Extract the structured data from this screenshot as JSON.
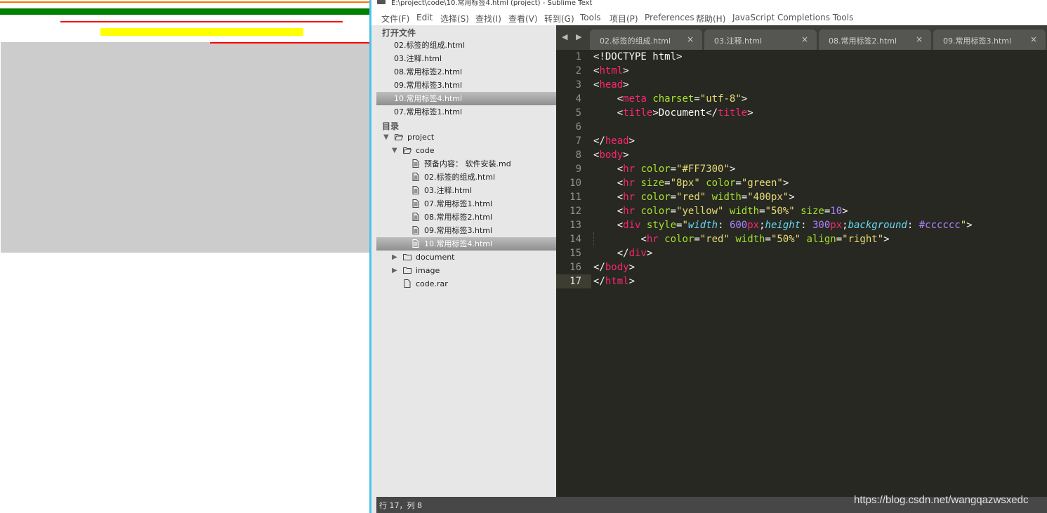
{
  "window": {
    "title": "E:\\project\\code\\10.常用标签4.html (project) - Sublime Text"
  },
  "menu": [
    "文件(F)",
    "Edit",
    "选择(S)",
    "查找(I)",
    "查看(V)",
    "转到(G)",
    "Tools",
    "项目(P)",
    "Preferences",
    "帮助(H)",
    "JavaScript Completions Tools"
  ],
  "sidebar": {
    "open_files_heading": "打开文件",
    "open_files": [
      {
        "label": "02.标签的组成.html"
      },
      {
        "label": "03.注释.html"
      },
      {
        "label": "08.常用标签2.html"
      },
      {
        "label": "09.常用标签3.html"
      },
      {
        "label": "10.常用标签4.html",
        "selected": true
      },
      {
        "label": "07.常用标签1.html"
      }
    ],
    "folders_heading": "目录",
    "tree": [
      {
        "label": "project",
        "type": "folder-open"
      },
      {
        "label": "code",
        "type": "folder-open"
      },
      {
        "label": "预备内容： 软件安装.md",
        "type": "file"
      },
      {
        "label": "02.标签的组成.html",
        "type": "file"
      },
      {
        "label": "03.注释.html",
        "type": "file"
      },
      {
        "label": "07.常用标签1.html",
        "type": "file"
      },
      {
        "label": "08.常用标签2.html",
        "type": "file"
      },
      {
        "label": "09.常用标签3.html",
        "type": "file"
      },
      {
        "label": "10.常用标签4.html",
        "type": "file",
        "selected": true
      },
      {
        "label": "document",
        "type": "folder"
      },
      {
        "label": "image",
        "type": "folder"
      },
      {
        "label": "code.rar",
        "type": "file"
      }
    ]
  },
  "tabs": [
    {
      "label": "02.标签的组成.html",
      "close": "×"
    },
    {
      "label": "03.注释.html",
      "close": "×"
    },
    {
      "label": "08.常用标签2.html",
      "close": "×"
    },
    {
      "label": "09.常用标签3.html",
      "close": "×"
    }
  ],
  "tab_nav": "◀ ▶",
  "code": {
    "line_numbers": [
      "1",
      "2",
      "3",
      "4",
      "5",
      "6",
      "7",
      "8",
      "9",
      "10",
      "11",
      "12",
      "13",
      "14",
      "15",
      "16",
      "17"
    ],
    "current_line": 17,
    "lines": [
      [
        [
          "text",
          "<!DOCTYPE html>"
        ]
      ],
      [
        [
          "pun",
          "<"
        ],
        [
          "tag",
          "html"
        ],
        [
          "pun",
          ">"
        ]
      ],
      [
        [
          "pun",
          "<"
        ],
        [
          "tag",
          "head"
        ],
        [
          "pun",
          ">"
        ]
      ],
      [
        [
          "pun",
          "    <"
        ],
        [
          "tag",
          "meta"
        ],
        [
          "pun",
          " "
        ],
        [
          "attr",
          "charset"
        ],
        [
          "pun",
          "="
        ],
        [
          "str",
          "\"utf-8\""
        ],
        [
          "pun",
          ">"
        ]
      ],
      [
        [
          "pun",
          "    <"
        ],
        [
          "tag",
          "title"
        ],
        [
          "pun",
          ">"
        ],
        [
          "text",
          "Document"
        ],
        [
          "pun",
          "</"
        ],
        [
          "tag",
          "title"
        ],
        [
          "pun",
          ">"
        ]
      ],
      [],
      [
        [
          "pun",
          "</"
        ],
        [
          "tag",
          "head"
        ],
        [
          "pun",
          ">"
        ]
      ],
      [
        [
          "pun",
          "<"
        ],
        [
          "tag",
          "body"
        ],
        [
          "pun",
          ">"
        ]
      ],
      [
        [
          "pun",
          "    <"
        ],
        [
          "tag",
          "hr"
        ],
        [
          "pun",
          " "
        ],
        [
          "attr",
          "color"
        ],
        [
          "pun",
          "="
        ],
        [
          "str",
          "\"#FF7300\""
        ],
        [
          "pun",
          ">"
        ]
      ],
      [
        [
          "pun",
          "    <"
        ],
        [
          "tag",
          "hr"
        ],
        [
          "pun",
          " "
        ],
        [
          "attr",
          "size"
        ],
        [
          "pun",
          "="
        ],
        [
          "str",
          "\"8px\""
        ],
        [
          "pun",
          " "
        ],
        [
          "attr",
          "color"
        ],
        [
          "pun",
          "="
        ],
        [
          "str",
          "\"green\""
        ],
        [
          "pun",
          ">"
        ]
      ],
      [
        [
          "pun",
          "    <"
        ],
        [
          "tag",
          "hr"
        ],
        [
          "pun",
          " "
        ],
        [
          "attr",
          "color"
        ],
        [
          "pun",
          "="
        ],
        [
          "str",
          "\"red\""
        ],
        [
          "pun",
          " "
        ],
        [
          "attr",
          "width"
        ],
        [
          "pun",
          "="
        ],
        [
          "str",
          "\"400px\""
        ],
        [
          "pun",
          ">"
        ]
      ],
      [
        [
          "pun",
          "    <"
        ],
        [
          "tag",
          "hr"
        ],
        [
          "pun",
          " "
        ],
        [
          "attr",
          "color"
        ],
        [
          "pun",
          "="
        ],
        [
          "str",
          "\"yellow\""
        ],
        [
          "pun",
          " "
        ],
        [
          "attr",
          "width"
        ],
        [
          "pun",
          "="
        ],
        [
          "str",
          "\"50%\""
        ],
        [
          "pun",
          " "
        ],
        [
          "attr",
          "size"
        ],
        [
          "pun",
          "="
        ],
        [
          "num",
          "10"
        ],
        [
          "pun",
          ">"
        ]
      ],
      [
        [
          "pun",
          "    <"
        ],
        [
          "tag",
          "div"
        ],
        [
          "pun",
          " "
        ],
        [
          "attr",
          "style"
        ],
        [
          "pun",
          "="
        ],
        [
          "str",
          "\""
        ],
        [
          "prop",
          "width"
        ],
        [
          "pun",
          ": "
        ],
        [
          "num",
          "600"
        ],
        [
          "tag",
          "px"
        ],
        [
          "pun",
          ";"
        ],
        [
          "prop",
          "height"
        ],
        [
          "pun",
          ": "
        ],
        [
          "num",
          "300"
        ],
        [
          "tag",
          "px"
        ],
        [
          "pun",
          ";"
        ],
        [
          "prop",
          "background"
        ],
        [
          "pun",
          ": "
        ],
        [
          "num",
          "#cccccc"
        ],
        [
          "str",
          "\""
        ],
        [
          "pun",
          ">"
        ]
      ],
      [
        [
          "pun",
          "        <"
        ],
        [
          "tag",
          "hr"
        ],
        [
          "pun",
          " "
        ],
        [
          "attr",
          "color"
        ],
        [
          "pun",
          "="
        ],
        [
          "str",
          "\"red\""
        ],
        [
          "pun",
          " "
        ],
        [
          "attr",
          "width"
        ],
        [
          "pun",
          "="
        ],
        [
          "str",
          "\"50%\""
        ],
        [
          "pun",
          " "
        ],
        [
          "attr",
          "align"
        ],
        [
          "pun",
          "="
        ],
        [
          "str",
          "\"right\""
        ],
        [
          "pun",
          ">"
        ]
      ],
      [
        [
          "pun",
          "    </"
        ],
        [
          "tag",
          "div"
        ],
        [
          "pun",
          ">"
        ]
      ],
      [
        [
          "pun",
          "</"
        ],
        [
          "tag",
          "body"
        ],
        [
          "pun",
          ">"
        ]
      ],
      [
        [
          "pun",
          "</"
        ],
        [
          "tag",
          "html"
        ],
        [
          "pun",
          ">"
        ]
      ]
    ]
  },
  "status": {
    "position": "行 17，列 8"
  },
  "watermark": "https://blog.csdn.net/wangqazwsxedc",
  "colors": {
    "hr_orange": "#FF7300",
    "hr_green": "#008000",
    "hr_red": "#ff0000",
    "hr_yellow": "#ffff00",
    "div_background": "#cccccc",
    "editor_bg": "#272822",
    "accent_divider": "#4cc3ea"
  }
}
